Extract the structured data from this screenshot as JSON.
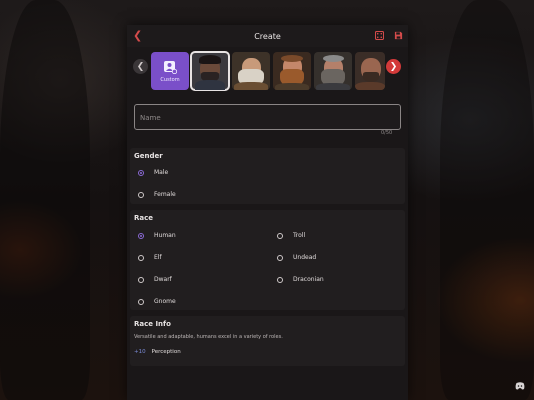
{
  "header": {
    "title": "Create"
  },
  "carousel": {
    "custom_label": "Custom",
    "portraits": [
      {
        "name": "portrait-1",
        "selected": true
      },
      {
        "name": "portrait-2",
        "selected": false
      },
      {
        "name": "portrait-3",
        "selected": false
      },
      {
        "name": "portrait-4",
        "selected": false
      },
      {
        "name": "portrait-5",
        "selected": false
      }
    ]
  },
  "name_field": {
    "placeholder": "Name",
    "value": "",
    "counter": "0/50"
  },
  "gender": {
    "title": "Gender",
    "options": [
      {
        "label": "Male",
        "selected": true
      },
      {
        "label": "Female",
        "selected": false
      }
    ]
  },
  "race": {
    "title": "Race",
    "options": [
      {
        "label": "Human",
        "selected": true
      },
      {
        "label": "Troll",
        "selected": false
      },
      {
        "label": "Elf",
        "selected": false
      },
      {
        "label": "Undead",
        "selected": false
      },
      {
        "label": "Dwarf",
        "selected": false
      },
      {
        "label": "Draconian",
        "selected": false
      },
      {
        "label": "Gnome",
        "selected": false
      }
    ]
  },
  "race_info": {
    "title": "Race Info",
    "description": "Versatile and adaptable, humans excel in a variety of roles.",
    "stat_value": "+10",
    "stat_name": "Perception"
  },
  "colors": {
    "accent": "#7a4fc9",
    "danger": "#d33a3a",
    "panel": "#1a1718",
    "section": "#211e1f"
  }
}
